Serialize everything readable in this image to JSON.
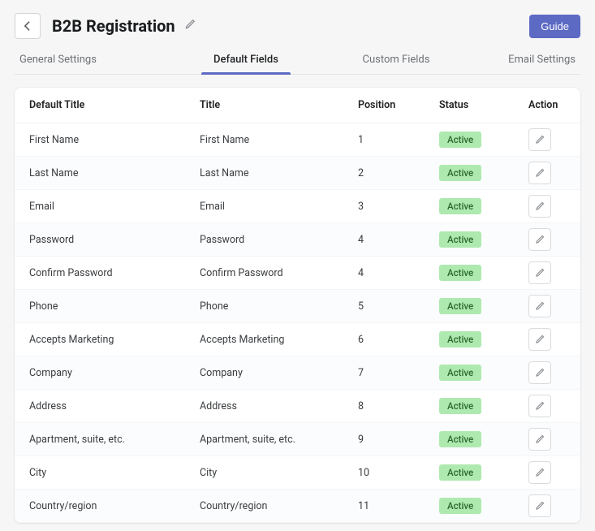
{
  "header": {
    "title": "B2B Registration",
    "guide_label": "Guide"
  },
  "tabs": [
    {
      "label": "General Settings",
      "active": false
    },
    {
      "label": "Default Fields",
      "active": true
    },
    {
      "label": "Custom Fields",
      "active": false
    },
    {
      "label": "Email Settings",
      "active": false
    }
  ],
  "table": {
    "columns": {
      "default_title": "Default Title",
      "title": "Title",
      "position": "Position",
      "status": "Status",
      "action": "Action"
    },
    "rows": [
      {
        "default_title": "First Name",
        "title": "First Name",
        "position": "1",
        "status": "Active"
      },
      {
        "default_title": "Last Name",
        "title": "Last Name",
        "position": "2",
        "status": "Active"
      },
      {
        "default_title": "Email",
        "title": "Email",
        "position": "3",
        "status": "Active"
      },
      {
        "default_title": "Password",
        "title": "Password",
        "position": "4",
        "status": "Active"
      },
      {
        "default_title": "Confirm Password",
        "title": "Confirm Password",
        "position": "4",
        "status": "Active"
      },
      {
        "default_title": "Phone",
        "title": "Phone",
        "position": "5",
        "status": "Active"
      },
      {
        "default_title": "Accepts Marketing",
        "title": "Accepts Marketing",
        "position": "6",
        "status": "Active"
      },
      {
        "default_title": "Company",
        "title": "Company",
        "position": "7",
        "status": "Active"
      },
      {
        "default_title": "Address",
        "title": "Address",
        "position": "8",
        "status": "Active"
      },
      {
        "default_title": "Apartment, suite, etc.",
        "title": "Apartment, suite, etc.",
        "position": "9",
        "status": "Active"
      },
      {
        "default_title": "City",
        "title": "City",
        "position": "10",
        "status": "Active"
      },
      {
        "default_title": "Country/region",
        "title": "Country/region",
        "position": "11",
        "status": "Active"
      }
    ]
  }
}
